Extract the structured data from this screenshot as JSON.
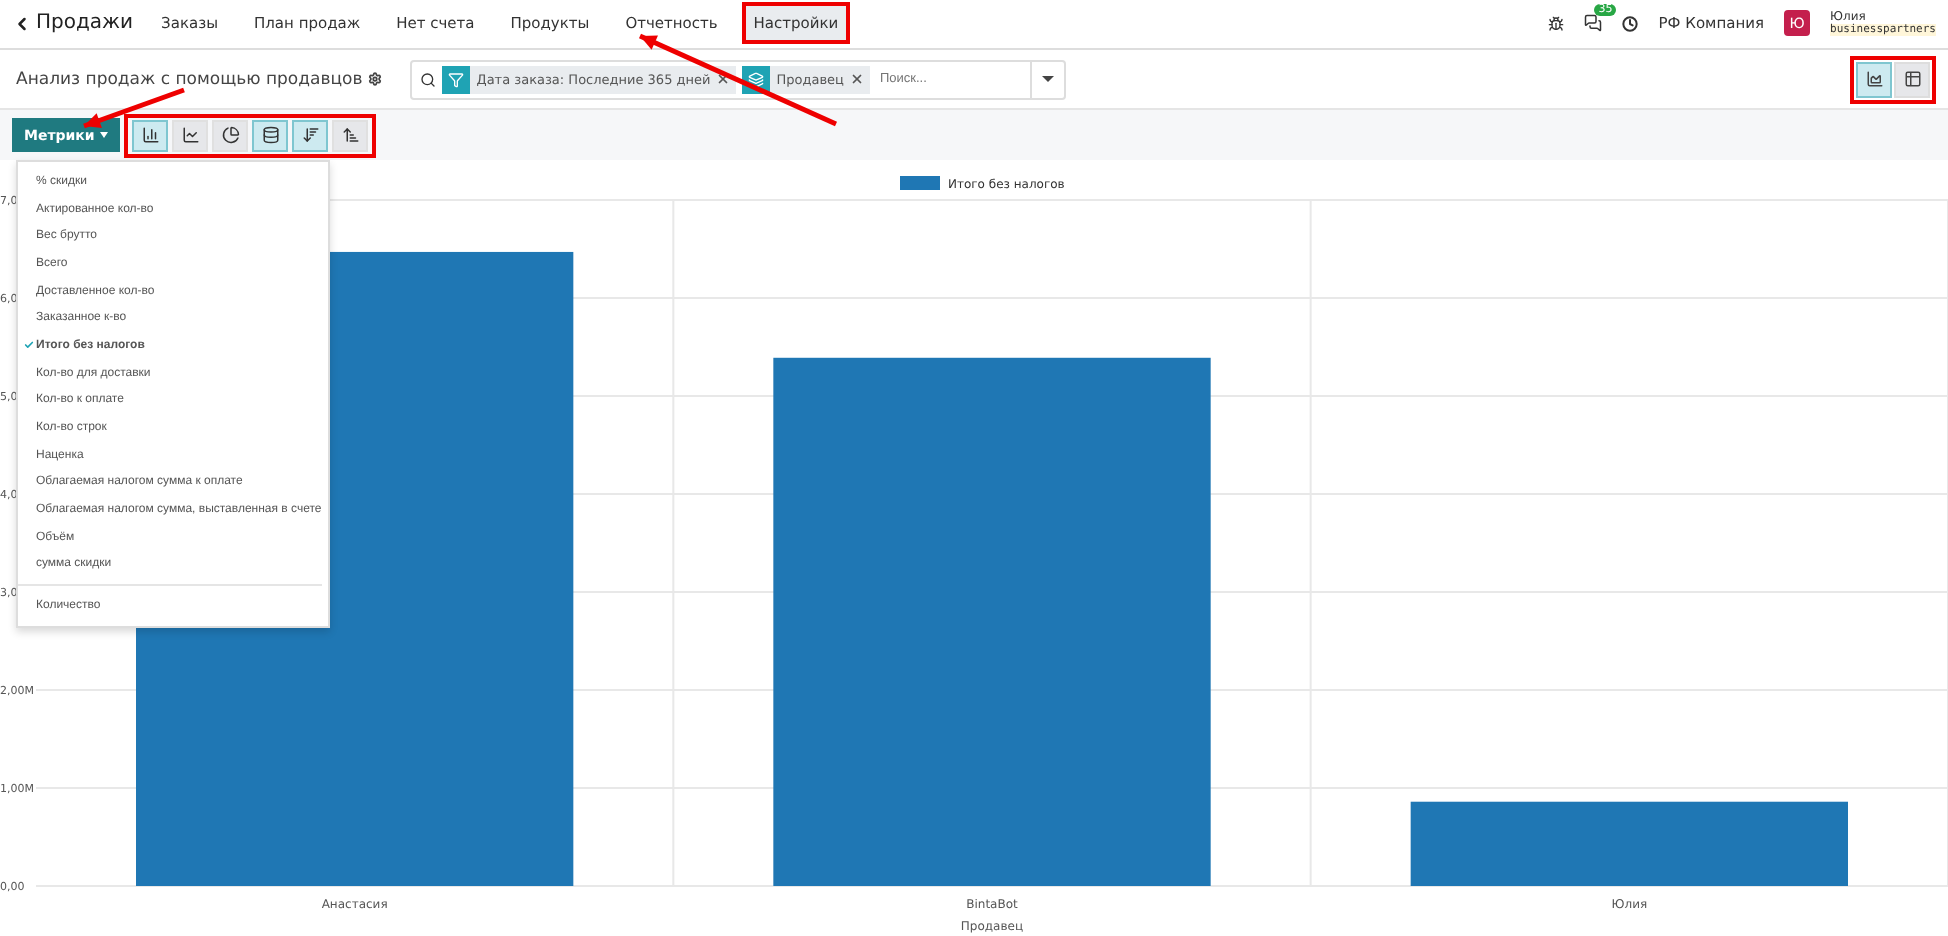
{
  "navbar": {
    "app": "Продажи",
    "menu": [
      {
        "label": "Заказы",
        "highlighted": false
      },
      {
        "label": "План продаж",
        "highlighted": false
      },
      {
        "label": "Нет счета",
        "highlighted": false
      },
      {
        "label": "Продукты",
        "highlighted": false
      },
      {
        "label": "Отчетность",
        "highlighted": false
      },
      {
        "label": "Настройки",
        "highlighted": true
      }
    ],
    "messages_badge": "35",
    "company": "РФ Компания",
    "user": {
      "initial": "Ю",
      "name": "Юлия",
      "database": "businesspartners"
    }
  },
  "control_panel": {
    "title": "Анализ продаж с помощью продавцов",
    "facets": [
      {
        "kind": "filter",
        "label": "Дата заказа: Последние 365 дней"
      },
      {
        "kind": "group",
        "label": "Продавец"
      }
    ],
    "search": {
      "placeholder": "Поиск..."
    },
    "views_highlighted": true,
    "views": [
      {
        "kind": "graph",
        "selected": true
      },
      {
        "kind": "pivot",
        "selected": false
      }
    ]
  },
  "toolbar": {
    "metrics_button": "Метрики",
    "highlighted": true,
    "buttons": [
      {
        "kind": "bar",
        "selected": true
      },
      {
        "kind": "line",
        "selected": false
      },
      {
        "kind": "pie",
        "selected": false
      },
      {
        "kind": "stacked",
        "selected": true
      },
      {
        "kind": "descending",
        "selected": true
      },
      {
        "kind": "ascending",
        "selected": false
      }
    ]
  },
  "metrics_menu": {
    "items": [
      {
        "label": "% скидки",
        "checked": false
      },
      {
        "label": "Актированное кол-во",
        "checked": false
      },
      {
        "label": "Вес брутто",
        "checked": false
      },
      {
        "label": "Всего",
        "checked": false
      },
      {
        "label": "Доставленное кол-во",
        "checked": false
      },
      {
        "label": "Заказанное к-во",
        "checked": false
      },
      {
        "label": "Итого без налогов",
        "checked": true
      },
      {
        "label": "Кол-во для доставки",
        "checked": false
      },
      {
        "label": "Кол-во к оплате",
        "checked": false
      },
      {
        "label": "Кол-во строк",
        "checked": false
      },
      {
        "label": "Наценка",
        "checked": false
      },
      {
        "label": "Облагаемая налогом сумма к оплате",
        "checked": false
      },
      {
        "label": "Облагаемая налогом сумма, выставленная в счете",
        "checked": false
      },
      {
        "label": "Объём",
        "checked": false
      },
      {
        "label": "сумма скидки",
        "checked": false
      }
    ],
    "footer_items": [
      {
        "label": "Количество",
        "checked": false
      }
    ]
  },
  "chart": {
    "chart_data": {
      "type": "bar",
      "xlabel": "Продавец",
      "categories": [
        "Анастасия",
        "BintaBot",
        "Юлия"
      ],
      "series": [
        {
          "name": "Итого без налогов",
          "color": "#1f77b4",
          "values": [
            6.47,
            5.39,
            0.86
          ]
        }
      ],
      "ylim": [
        0,
        7
      ],
      "grid": true,
      "yticks": [
        {
          "value": 0,
          "label": "0,00"
        },
        {
          "value": 1,
          "label": "1,00M"
        },
        {
          "value": 2,
          "label": "2,00M"
        },
        {
          "value": 3,
          "label": "3,0"
        },
        {
          "value": 4,
          "label": "4,0"
        },
        {
          "value": 5,
          "label": "5,0"
        },
        {
          "value": 6,
          "label": "6,0"
        },
        {
          "value": 7,
          "label": "7,0"
        }
      ]
    }
  }
}
